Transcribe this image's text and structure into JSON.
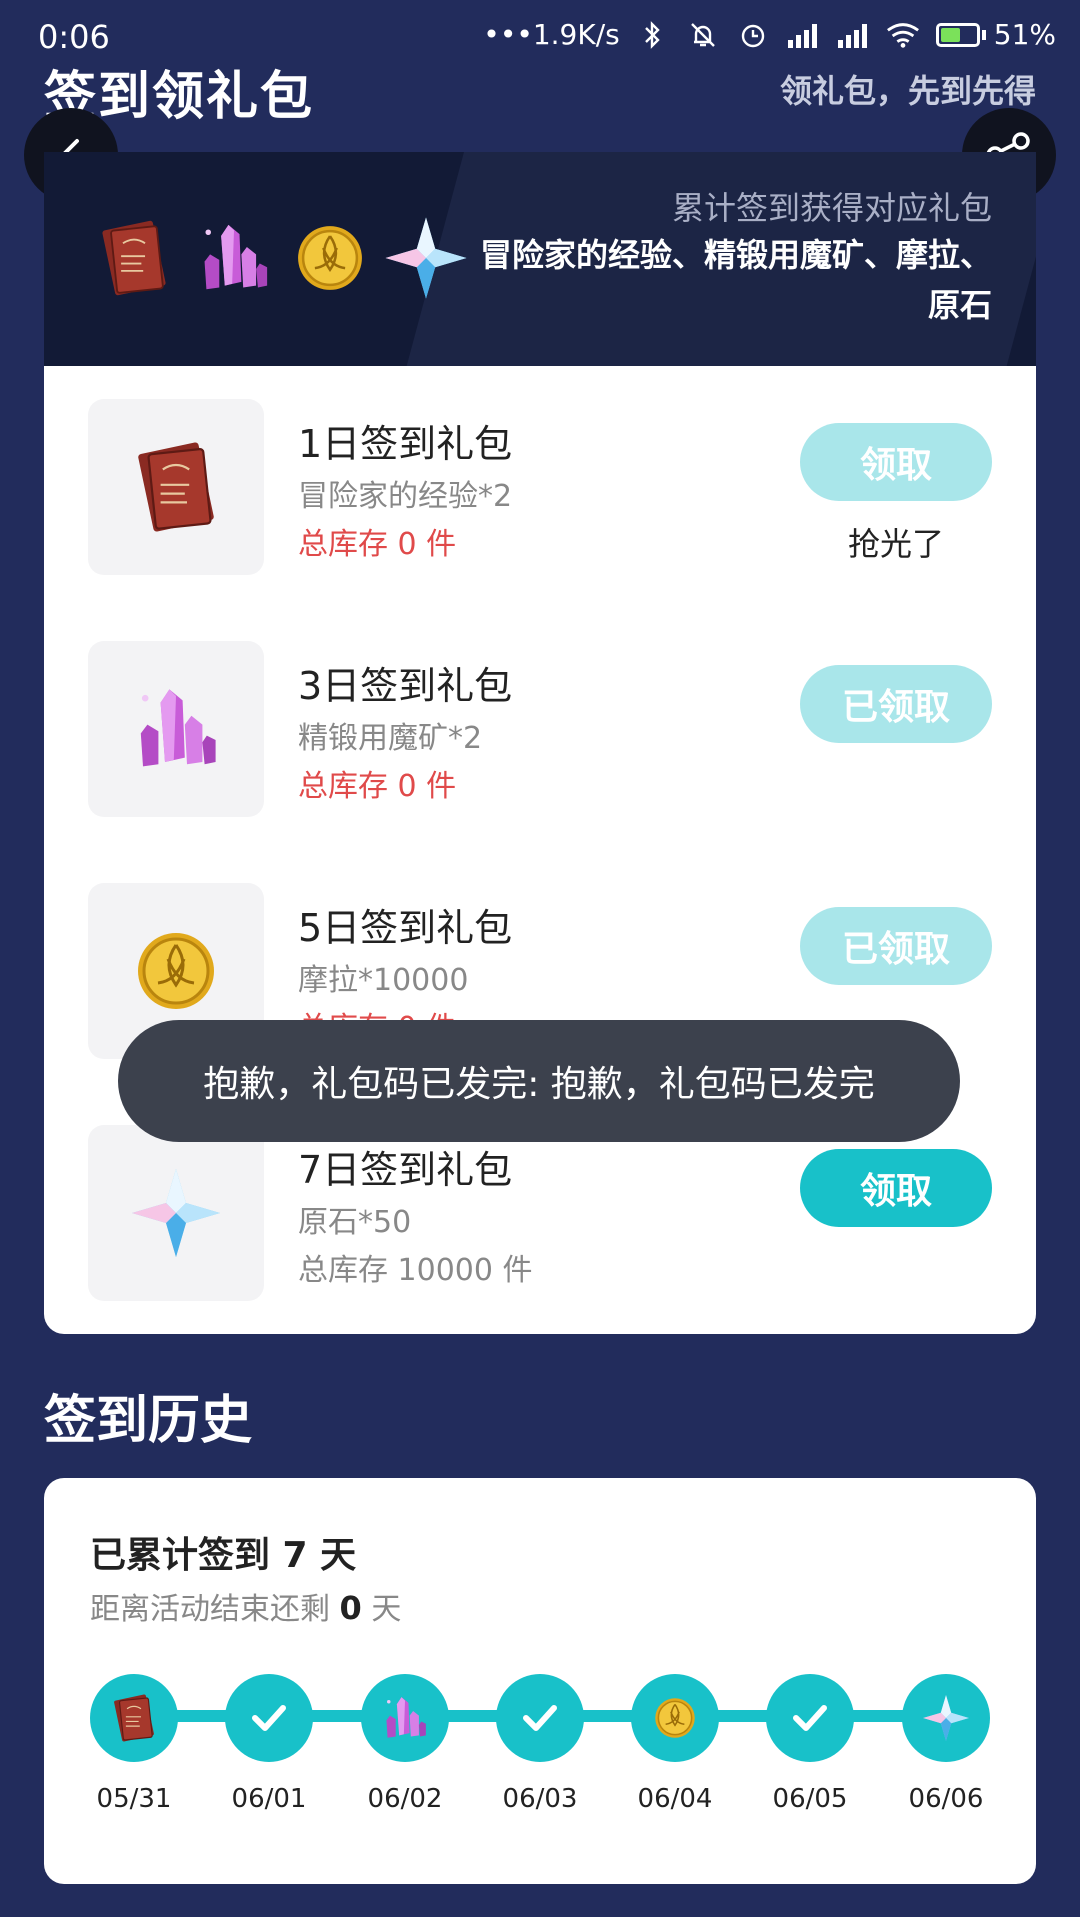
{
  "status_bar": {
    "time": "0:06",
    "network_speed": "1.9K/s",
    "battery": "51%",
    "battery_level": 0.51,
    "icons": [
      "bluetooth-icon",
      "mute-icon",
      "alarm-icon",
      "signal-hd-icon",
      "signal-icon",
      "wifi-icon",
      "battery-icon"
    ]
  },
  "header": {
    "title": "签到领礼包",
    "subtitle": "领礼包，先到先得",
    "back_icon": "chevron-left-icon",
    "share_icon": "share-icon"
  },
  "banner": {
    "hint": "累计签到获得对应礼包",
    "items": "冒险家的经验、精锻用魔矿、摩拉、原石"
  },
  "gifts": [
    {
      "name": "1日签到礼包",
      "content": "冒险家的经验*2",
      "stock": "总库存 0 件",
      "stock_color": "#e04a4a",
      "button": "领取",
      "status": "抢光了",
      "icon": "book-icon"
    },
    {
      "name": "3日签到礼包",
      "content": "精锻用魔矿*2",
      "stock": "总库存 0 件",
      "stock_color": "#e04a4a",
      "button": "已领取",
      "status": "",
      "icon": "crystal-icon"
    },
    {
      "name": "5日签到礼包",
      "content": "摩拉*10000",
      "stock": "总库存 0 件",
      "stock_color": "#e04a4a",
      "button": "已领取",
      "status": "",
      "icon": "coin-icon"
    },
    {
      "name": "7日签到礼包",
      "content": "原石*50",
      "stock": "总库存 10000 件",
      "stock_color": "#888888",
      "button": "领取",
      "status": "",
      "icon": "star-gem-icon"
    }
  ],
  "toast": "抱歉，礼包码已发完: 抱歉，礼包码已发完",
  "history": {
    "title": "签到历史",
    "total": "已累计签到 7 天",
    "remain_prefix": "距离活动结束还剩",
    "remain_days": "0",
    "remain_suffix": "天",
    "days": [
      {
        "date": "05/31",
        "icon": "book-icon"
      },
      {
        "date": "06/01",
        "icon": "check-icon"
      },
      {
        "date": "06/02",
        "icon": "crystal-icon"
      },
      {
        "date": "06/03",
        "icon": "check-icon"
      },
      {
        "date": "06/04",
        "icon": "coin-icon"
      },
      {
        "date": "06/05",
        "icon": "check-icon"
      },
      {
        "date": "06/06",
        "icon": "star-gem-icon"
      }
    ]
  },
  "colors": {
    "background": "#222c5c",
    "accent": "#18c1c9",
    "accent_disabled": "#a9e6ea",
    "stock_red": "#e04a4a"
  }
}
